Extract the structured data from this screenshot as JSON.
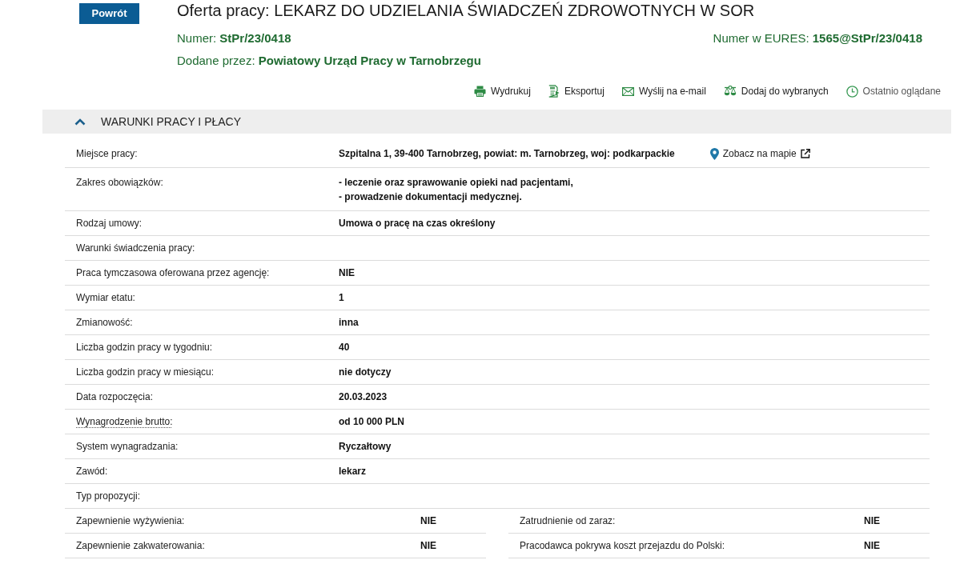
{
  "back_button": "Powrót",
  "offer": {
    "title": "Oferta pracy: LEKARZ DO UDZIELANIA ŚWIADCZEŃ ZDROWOTNYCH W SOR",
    "number_label": "Numer:",
    "number": "StPr/23/0418",
    "eures_label": "Numer w EURES:",
    "eures_number": "1565@StPr/23/0418",
    "added_by_label": "Dodane przez:",
    "added_by": "Powiatowy Urząd Pracy w Tarnobrzegu"
  },
  "actions": [
    {
      "kind": "print",
      "label": "Wydrukuj"
    },
    {
      "kind": "export",
      "label": "Eksportuj"
    },
    {
      "kind": "email",
      "label": "Wyślij na e-mail"
    },
    {
      "kind": "favorites",
      "label": "Dodaj do wybranych"
    },
    {
      "kind": "recent",
      "label": "Ostatnio oglądane"
    }
  ],
  "section": {
    "title": "WARUNKI PRACY I PŁACY",
    "expanded": true,
    "rows": [
      {
        "label": "Miejsce pracy:",
        "lines": [
          "Szpitalna 1, 39-400 Tarnobrzeg, powiat: m. Tarnobrzeg, woj: podkarpackie"
        ],
        "link": "Zobacz na mapie"
      },
      {
        "label": "Zakres obowiązków:",
        "lines": [
          "- leczenie oraz sprawowanie opieki nad pacjentami,",
          "- prowadzenie dokumentacji medycznej."
        ]
      },
      {
        "label": "Rodzaj umowy:",
        "lines": [
          "Umowa o pracę na czas określony"
        ]
      },
      {
        "label": "Warunki świadczenia pracy:"
      },
      {
        "label": "Praca tymczasowa oferowana przez agencję:",
        "lines": [
          "NIE"
        ]
      },
      {
        "label": "Wymiar etatu:",
        "lines": [
          "1"
        ]
      },
      {
        "label": "Zmianowość:",
        "lines": [
          "inna"
        ]
      },
      {
        "label": "Liczba godzin pracy w tygodniu:",
        "lines": [
          "40"
        ]
      },
      {
        "label": "Liczba godzin pracy w miesiącu:",
        "lines": [
          "nie dotyczy"
        ]
      },
      {
        "label": "Data rozpoczęcia:",
        "lines": [
          "20.03.2023"
        ]
      },
      {
        "label": "Wynagrodzenie brutto:",
        "hint": true,
        "lines": [
          "od 10 000 PLN"
        ]
      },
      {
        "label": "System wynagradzania:",
        "lines": [
          "Ryczałtowy"
        ]
      },
      {
        "label": "Zawód:",
        "lines": [
          "lekarz"
        ]
      },
      {
        "label": "Typ propozycji:"
      }
    ],
    "pair_rows": [
      [
        {
          "label": "Zapewnienie wyżywienia:",
          "value": "NIE"
        },
        {
          "label": "Zatrudnienie od zaraz:",
          "value": "NIE"
        }
      ],
      [
        {
          "label": "Zapewnienie zakwaterowania:",
          "value": "NIE"
        },
        {
          "label": "Pracodawca pokrywa koszt przejazdu do Polski:",
          "value": "NIE"
        }
      ]
    ]
  }
}
